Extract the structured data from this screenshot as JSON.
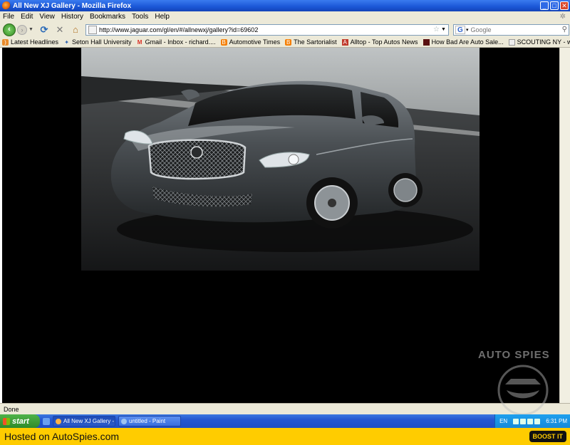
{
  "window": {
    "title": "All New XJ Gallery - Mozilla Firefox",
    "controls": {
      "minimize": "_",
      "maximize": "□",
      "close": "✕"
    }
  },
  "menu": [
    "File",
    "Edit",
    "View",
    "History",
    "Bookmarks",
    "Tools",
    "Help"
  ],
  "nav": {
    "url": "http://www.jaguar.com/gl/en/#/allnewxj/gallery?id=69602",
    "search_placeholder": "Google",
    "search_engine_icon": "google-icon"
  },
  "bookmarks": [
    {
      "label": "Latest Headlines",
      "icon": "rss-icon",
      "color": "#e98b2a"
    },
    {
      "label": "Seton Hall University",
      "icon": "star-icon",
      "color": "#2a5fb0"
    },
    {
      "label": "Gmail - Inbox - richard....",
      "icon": "gmail-icon",
      "color": "#d93025"
    },
    {
      "label": "Automotive Times",
      "icon": "blogger-icon",
      "color": "#f57d00"
    },
    {
      "label": "The Sartorialist",
      "icon": "blogger-icon",
      "color": "#f57d00"
    },
    {
      "label": "Alltop - Top Autos News",
      "icon": "alltop-icon",
      "color": "#c0392b"
    },
    {
      "label": "How Bad Are Auto Sale...",
      "icon": "site-icon",
      "color": "#5a1010"
    },
    {
      "label": "SCOUTING NY - www.s...",
      "icon": "page-icon",
      "color": "#dddddd"
    }
  ],
  "status": "Done",
  "watermark": "AUTO SPIES",
  "taskbar": {
    "start_label": "start",
    "tasks": [
      {
        "label": "All New XJ Gallery - M...",
        "active": true
      },
      {
        "label": "untitled - Paint",
        "active": false
      }
    ],
    "lang": "EN",
    "clock": "6:31 PM"
  },
  "banner": {
    "hosted": "Hosted on AutoSpies.com",
    "boost": "BOOST IT"
  },
  "colors": {
    "titlebar": "#1a56d6",
    "chrome": "#ece9d8",
    "banner": "#ffcc00",
    "car_body": "#4a4f53"
  }
}
